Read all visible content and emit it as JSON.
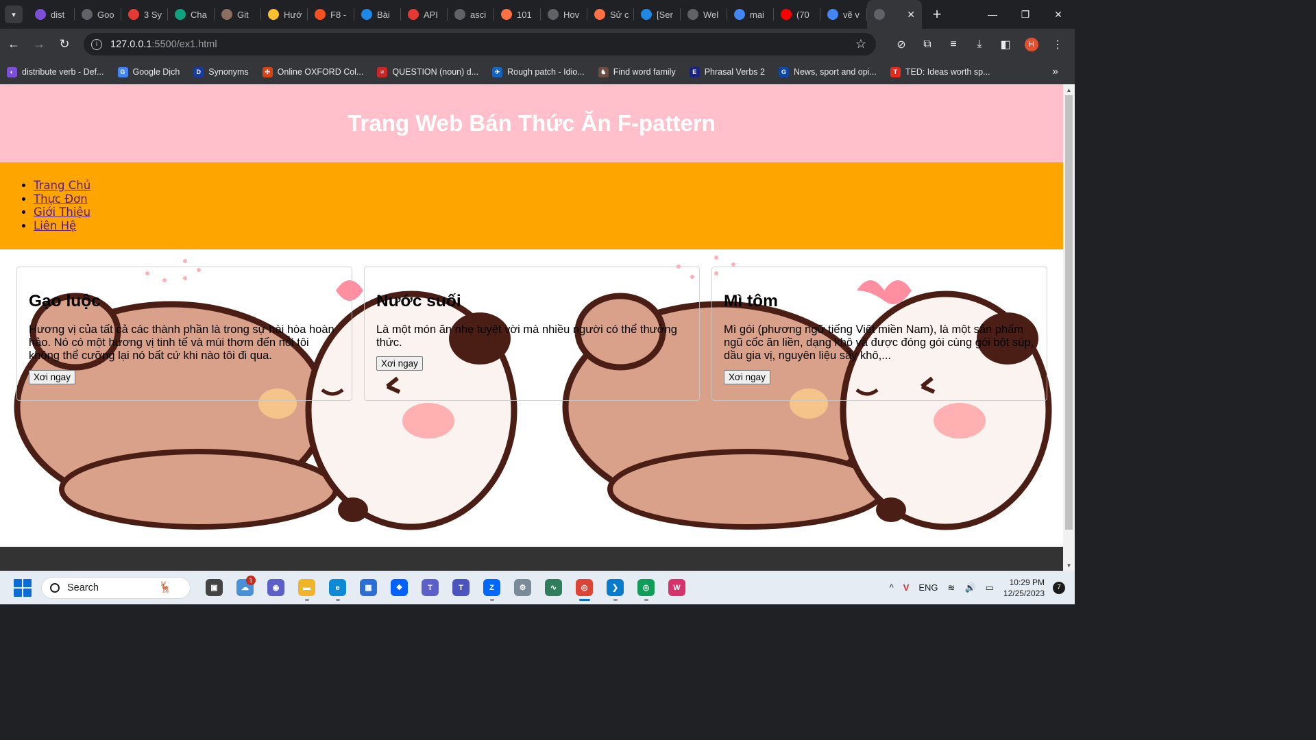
{
  "browser": {
    "tabs": [
      {
        "label": "dist",
        "icon": "globe-icon",
        "color": "#7b4fd6"
      },
      {
        "label": "Goo",
        "icon": "chrome-icon",
        "color": "#5f6368"
      },
      {
        "label": "3 Sy",
        "icon": "t-icon",
        "color": "#e53935"
      },
      {
        "label": "Cha",
        "icon": "chatgpt-icon",
        "color": "#10a37f"
      },
      {
        "label": "Git",
        "icon": "box-icon",
        "color": "#8d6e63"
      },
      {
        "label": "Hướ",
        "icon": "star-icon",
        "color": "#fbc02d"
      },
      {
        "label": "F8 -",
        "icon": "f8-icon",
        "color": "#f4511e"
      },
      {
        "label": "Bài",
        "icon": "drive-icon",
        "color": "#1e88e5"
      },
      {
        "label": "API",
        "icon": "t-icon",
        "color": "#e53935"
      },
      {
        "label": "asci",
        "icon": "github-icon",
        "color": "#5f6368"
      },
      {
        "label": "101",
        "icon": "target-icon",
        "color": "#ff7043"
      },
      {
        "label": "Hov",
        "icon": "chrome-icon",
        "color": "#5f6368"
      },
      {
        "label": "Sử c",
        "icon": "target-icon",
        "color": "#ff7043"
      },
      {
        "label": "[Ser",
        "icon": "check-icon",
        "color": "#1e88e5"
      },
      {
        "label": "Wel",
        "icon": "globe-icon",
        "color": "#5f6368"
      },
      {
        "label": "mai",
        "icon": "google-icon",
        "color": "#4285f4"
      },
      {
        "label": "(70",
        "icon": "youtube-icon",
        "color": "#ff0000"
      },
      {
        "label": "vẽ v",
        "icon": "google-icon",
        "color": "#4285f4"
      }
    ],
    "active_tab": {
      "label": "",
      "close": "✕"
    },
    "new_tab": "+",
    "window_controls": {
      "minimize": "—",
      "maximize": "❐",
      "close": "✕"
    },
    "url": {
      "host": "127.0.0.1",
      "rest": ":5500/ex1.html"
    },
    "profile_initial": "H",
    "bookmarks": [
      {
        "label": "distribute verb - Def...",
        "color": "#7b4fd6",
        "glyph": "◐"
      },
      {
        "label": "Google Dịch",
        "color": "#4285f4",
        "glyph": "G"
      },
      {
        "label": "Synonyms",
        "color": "#1a3a9c",
        "glyph": "D"
      },
      {
        "label": "Online OXFORD Col...",
        "color": "#d84315",
        "glyph": "✣"
      },
      {
        "label": "QUESTION (noun) d...",
        "color": "#c62828",
        "glyph": "≈"
      },
      {
        "label": "Rough patch - Idio...",
        "color": "#1565c0",
        "glyph": "✈"
      },
      {
        "label": "Find word family",
        "color": "#6d4c41",
        "glyph": "♞"
      },
      {
        "label": "Phrasal Verbs  2",
        "color": "#1a237e",
        "glyph": "E"
      },
      {
        "label": "News, sport and opi...",
        "color": "#0d47a1",
        "glyph": "G"
      },
      {
        "label": "TED: Ideas worth sp...",
        "color": "#e62b1e",
        "glyph": "T"
      }
    ],
    "bookmarks_more": "»"
  },
  "page": {
    "title": "Trang Web Bán Thức Ăn F-pattern",
    "nav": [
      "Trang Chủ",
      "Thực Đơn",
      "Giới Thiệu",
      "Liên Hệ"
    ],
    "cards": [
      {
        "title": "Gạo luộc",
        "text": "Hương vị của tất cả các thành phần là trong sự hài hòa hoàn hảo. Nó có một hương vị tinh tế và mùi thơm đến nỗi tôi không thể cưỡng lại nó bất cứ khi nào tôi đi qua.",
        "button": "Xơi ngay"
      },
      {
        "title": "Nước suối",
        "text": "Là một món ăn nhẹ tuyệt vời mà nhiều người có thể thưởng thức.",
        "button": "Xơi ngay"
      },
      {
        "title": "Mì tôm",
        "text": "Mì gói (phương ngữ tiếng Việt miền Nam), là một sản phẩm ngũ cốc ăn liền, dạng khô và được đóng gói cùng gói bột súp, dầu gia vị, nguyên liệu sấy khô,...",
        "button": "Xơi ngay"
      }
    ],
    "colors": {
      "header_bg": "#ffc0cb",
      "nav_bg": "#ffa500",
      "footer_bg": "#333333"
    }
  },
  "taskbar": {
    "search_placeholder": "Search",
    "apps": [
      {
        "name": "task-view",
        "color": "#444",
        "glyph": "▣"
      },
      {
        "name": "weather",
        "color": "#4a90d9",
        "glyph": "☁",
        "badge": "1"
      },
      {
        "name": "chat",
        "color": "#5b5fc7",
        "glyph": "◉"
      },
      {
        "name": "file-explorer",
        "color": "#f0b429",
        "glyph": "▬"
      },
      {
        "name": "edge",
        "color": "#0c8ad6",
        "glyph": "e"
      },
      {
        "name": "store",
        "color": "#2b6fd6",
        "glyph": "▦"
      },
      {
        "name": "dropbox",
        "color": "#0061fe",
        "glyph": "❖"
      },
      {
        "name": "teams-free",
        "color": "#5b5fc7",
        "glyph": "T"
      },
      {
        "name": "teams",
        "color": "#4b53bc",
        "glyph": "T"
      },
      {
        "name": "zalo",
        "color": "#0068ff",
        "glyph": "Z"
      },
      {
        "name": "settings",
        "color": "#7a8a99",
        "glyph": "⚙"
      },
      {
        "name": "activity",
        "color": "#2e7d5b",
        "glyph": "∿"
      },
      {
        "name": "chrome",
        "color": "#db4437",
        "glyph": "◎"
      },
      {
        "name": "vscode",
        "color": "#0a7acc",
        "glyph": "❯"
      },
      {
        "name": "chrome-profile",
        "color": "#0f9d58",
        "glyph": "◎"
      },
      {
        "name": "app-w",
        "color": "#d6336c",
        "glyph": "W"
      }
    ],
    "tray": {
      "chevron": "^",
      "lang": "ENG",
      "time": "10:29 PM",
      "date": "12/25/2023",
      "notifications": "7"
    }
  }
}
